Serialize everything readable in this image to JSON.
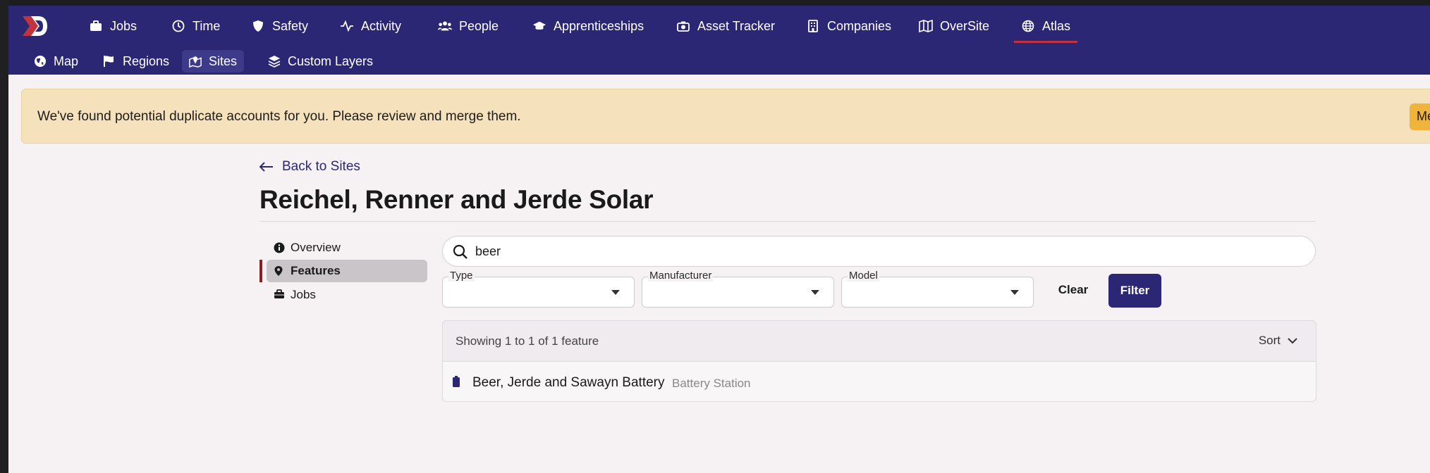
{
  "nav": {
    "items": [
      {
        "label": "Jobs",
        "icon": "briefcase-icon"
      },
      {
        "label": "Time",
        "icon": "clock-icon"
      },
      {
        "label": "Safety",
        "icon": "shield-icon"
      },
      {
        "label": "Activity",
        "icon": "pulse-icon"
      },
      {
        "label": "People",
        "icon": "people-icon"
      },
      {
        "label": "Apprenticeships",
        "icon": "graduation-cap-icon"
      },
      {
        "label": "Asset Tracker",
        "icon": "camera-icon"
      },
      {
        "label": "Companies",
        "icon": "building-icon"
      },
      {
        "label": "OverSite",
        "icon": "map-icon"
      },
      {
        "label": "Atlas",
        "icon": "globe-icon",
        "active": true
      }
    ],
    "active_underline_color": "#c2333c"
  },
  "subnav": {
    "items": [
      {
        "label": "Map",
        "icon": "globe-icon"
      },
      {
        "label": "Regions",
        "icon": "flag-icon"
      },
      {
        "label": "Sites",
        "icon": "map-pin-icon",
        "active": true
      },
      {
        "label": "Custom Layers",
        "icon": "layers-icon"
      }
    ]
  },
  "alert": {
    "message": "We've found potential duplicate accounts for you. Please review and merge them.",
    "button_label": "Me"
  },
  "page": {
    "back_label": "Back to Sites",
    "title": "Reichel, Renner and Jerde Solar"
  },
  "sidebar": {
    "items": [
      {
        "label": "Overview",
        "icon": "info-icon"
      },
      {
        "label": "Features",
        "icon": "location-pin-icon",
        "active": true
      },
      {
        "label": "Jobs",
        "icon": "briefcase-icon"
      }
    ]
  },
  "search": {
    "value": "beer",
    "placeholder": ""
  },
  "filters": {
    "type_label": "Type",
    "type_value": "",
    "manufacturer_label": "Manufacturer",
    "manufacturer_value": "",
    "model_label": "Model",
    "model_value": "",
    "clear_label": "Clear",
    "filter_label": "Filter"
  },
  "results": {
    "count_text": "Showing 1 to 1 of 1 feature",
    "sort_label": "Sort",
    "features": [
      {
        "name": "Beer, Jerde and Sawayn Battery",
        "type": "Battery Station",
        "icon": "battery-icon"
      }
    ]
  },
  "colors": {
    "brand": "#2c2775",
    "accent_red": "#c2333c",
    "alert_bg": "#f5e2bc",
    "alert_button": "#f0b43b"
  }
}
